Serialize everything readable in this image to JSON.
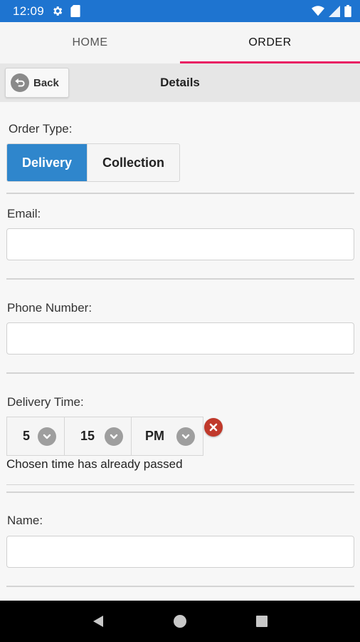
{
  "status_bar": {
    "time": "12:09",
    "icons": [
      "gear-icon",
      "sim-card-icon",
      "wifi-icon",
      "signal-icon",
      "battery-icon"
    ]
  },
  "tabs": [
    {
      "label": "HOME",
      "active": false
    },
    {
      "label": "ORDER",
      "active": true
    }
  ],
  "header": {
    "back_label": "Back",
    "title": "Details"
  },
  "form": {
    "order_type_label": "Order Type:",
    "order_types": [
      {
        "label": "Delivery",
        "selected": true
      },
      {
        "label": "Collection",
        "selected": false
      }
    ],
    "email_label": "Email:",
    "email_value": "",
    "phone_label": "Phone Number:",
    "phone_value": "",
    "delivery_time_label": "Delivery Time:",
    "delivery_time": {
      "hour": "5",
      "minute": "15",
      "period": "PM"
    },
    "time_error": "Chosen time has already passed",
    "name_label": "Name:",
    "name_value": ""
  },
  "colors": {
    "status_bar": "#1e74d0",
    "tab_indicator": "#e91e63",
    "segment_selected": "#2f86cc",
    "error_icon": "#c0392b"
  },
  "nav_bar": {
    "icons": [
      "back-triangle-icon",
      "home-circle-icon",
      "recents-square-icon"
    ]
  }
}
